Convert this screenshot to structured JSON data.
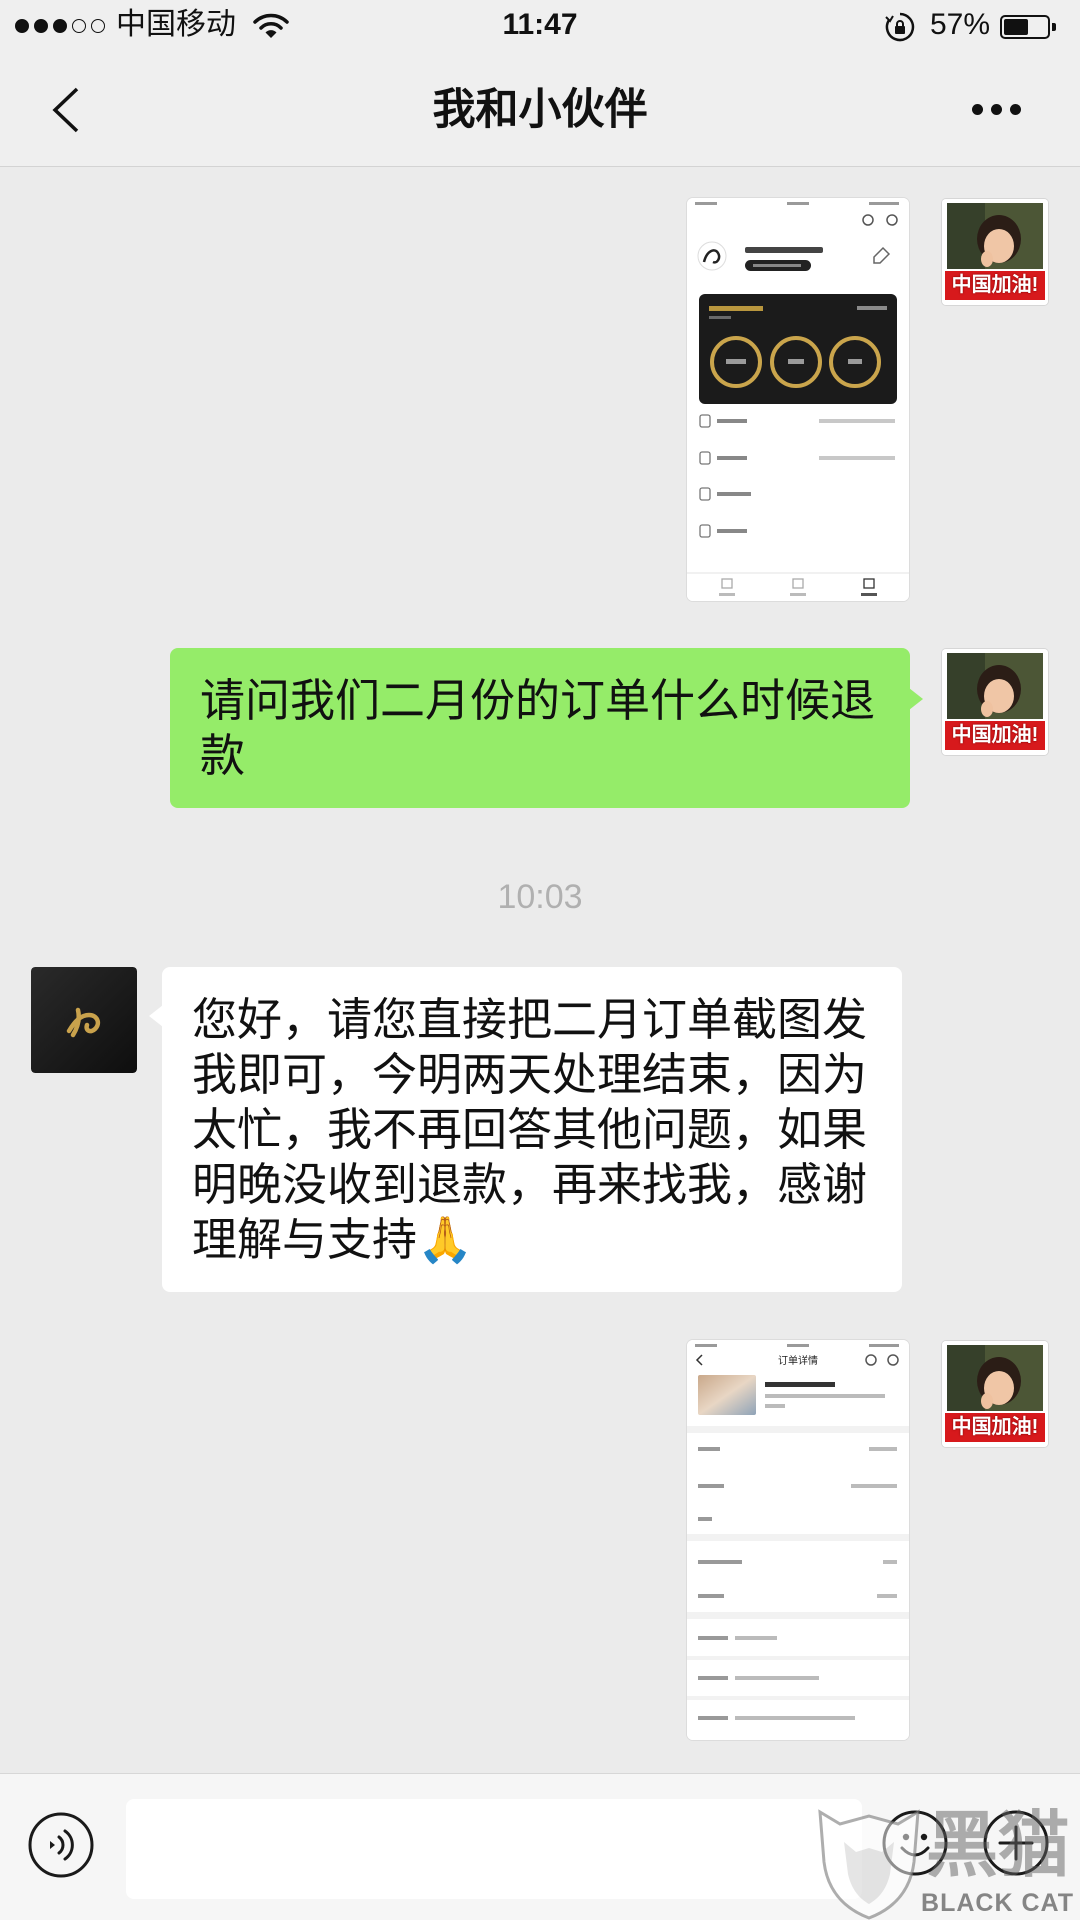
{
  "status_bar": {
    "signal_strength": 3,
    "signal_max": 5,
    "carrier": "中国移动",
    "time": "11:47",
    "battery_text": "57%",
    "battery_level": 0.57,
    "icons": [
      "wifi-icon",
      "rotation-lock-icon",
      "battery-icon"
    ]
  },
  "nav_bar": {
    "title": "我和小伙伴",
    "icons": [
      "chevron-left-icon",
      "more-dots-icon"
    ]
  },
  "chat": {
    "sent_image_1": {
      "avatar_banner": "中国加油!"
    },
    "sent_text": {
      "lines": [
        "请问我们二月份的订单什么时候退",
        "款"
      ],
      "avatar_banner": "中国加油!"
    },
    "timestamp": "10:03",
    "received_text": {
      "lines": [
        "您好，请您直接把二月订单截图发",
        "我即可，今明两天处理结束，因为",
        "太忙，我不再回答其他问题，如果",
        "明晚没收到退款，再来找我，感谢",
        "理解与支持🙏"
      ]
    },
    "sent_image_2": {
      "thumbnail_title": "订单详情",
      "avatar_banner": "中国加油!"
    }
  },
  "input_bar": {
    "value": "",
    "icons": [
      "voice-icon",
      "emoji-icon",
      "plus-icon"
    ]
  },
  "watermark": {
    "cn": "黑猫",
    "en": "BLACK CAT"
  },
  "colors": {
    "chat_background": "#ebebeb",
    "sent_bubble": "#95ec69",
    "received_bubble": "#ffffff",
    "timestamp_text": "#b0b0b0"
  }
}
